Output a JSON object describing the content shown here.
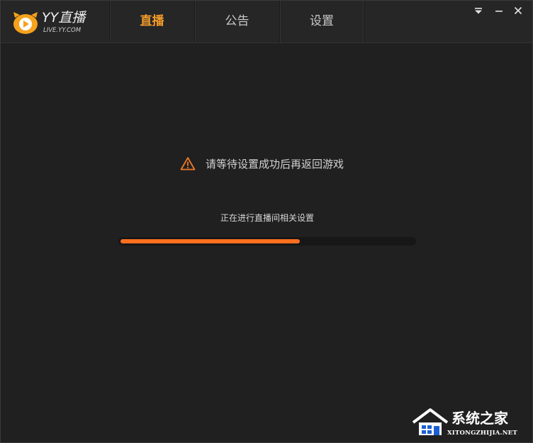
{
  "app": {
    "logo_title": "YY直播",
    "logo_subtitle": "LIVE.YY.COM",
    "logo_icon": "yy-play-logo-icon"
  },
  "tabs": [
    {
      "label": "直播",
      "active": true
    },
    {
      "label": "公告",
      "active": false
    },
    {
      "label": "设置",
      "active": false
    }
  ],
  "window_controls": {
    "menu_icon": "dropdown-menu-icon",
    "minimize_icon": "minimize-icon",
    "close_icon": "close-icon"
  },
  "message": {
    "icon": "warning-icon",
    "text": "请等待设置成功后再返回游戏"
  },
  "progress": {
    "label": "正在进行直播间相关设置",
    "value": 0.61
  },
  "watermark": {
    "name": "系统之家",
    "url": "XITONGZHIJIA.NET",
    "icon": "house-logo-icon"
  },
  "colors": {
    "background": "#202020",
    "titlebar": "#262626",
    "accent_tab": "#f39b2a",
    "progress_fill": "#ff6f1f",
    "progress_track": "#171717",
    "warning": "#f07a26"
  }
}
